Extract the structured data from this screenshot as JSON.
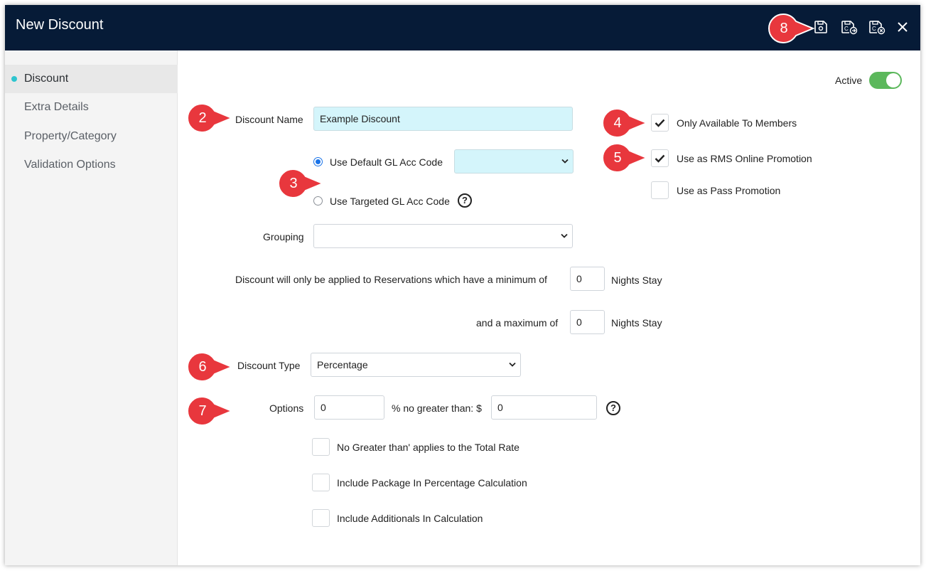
{
  "window": {
    "title": "New Discount"
  },
  "toolbar": {
    "icons": [
      "save-icon",
      "save-and-copy-icon",
      "save-and-close-icon",
      "close-icon"
    ]
  },
  "sidebar": {
    "items": [
      {
        "label": "Discount",
        "active": true
      },
      {
        "label": "Extra Details",
        "active": false
      },
      {
        "label": "Property/Category",
        "active": false
      },
      {
        "label": "Validation Options",
        "active": false
      }
    ]
  },
  "form": {
    "active_label": "Active",
    "active": true,
    "discount_name_label": "Discount Name",
    "discount_name_value": "Example Discount",
    "gl_default_label": "Use Default GL Acc Code",
    "gl_default_selected": true,
    "gl_default_value": "",
    "gl_targeted_label": "Use Targeted GL Acc Code",
    "gl_targeted_selected": false,
    "grouping_label": "Grouping",
    "grouping_value": "",
    "min_nights_prefix": "Discount will only be applied to Reservations which have a minimum of",
    "min_nights_value": "0",
    "nights_suffix": "Nights Stay",
    "max_nights_prefix": "and a maximum of",
    "max_nights_value": "0",
    "discount_type_label": "Discount Type",
    "discount_type_value": "Percentage",
    "options_label": "Options",
    "percent_value": "0",
    "no_greater_label": "% no greater than: $",
    "no_greater_value": "0",
    "members_only_label": "Only Available To Members",
    "members_only": true,
    "rms_online_label": "Use as RMS Online Promotion",
    "rms_online": true,
    "pass_promo_label": "Use as Pass Promotion",
    "pass_promo": false,
    "total_rate_label": "No Greater than' applies to the Total Rate",
    "total_rate": false,
    "include_package_label": "Include Package In Percentage Calculation",
    "include_package": false,
    "include_additionals_label": "Include Additionals In Calculation",
    "include_additionals": false
  },
  "annotations": [
    "2",
    "3",
    "4",
    "5",
    "6",
    "7",
    "8"
  ],
  "colors": {
    "titlebar": "#061b37",
    "accent": "#2ec5cf",
    "toggle_on": "#5cb85c",
    "highlight_input": "#d4f5fb",
    "badge": "#e8373d"
  }
}
